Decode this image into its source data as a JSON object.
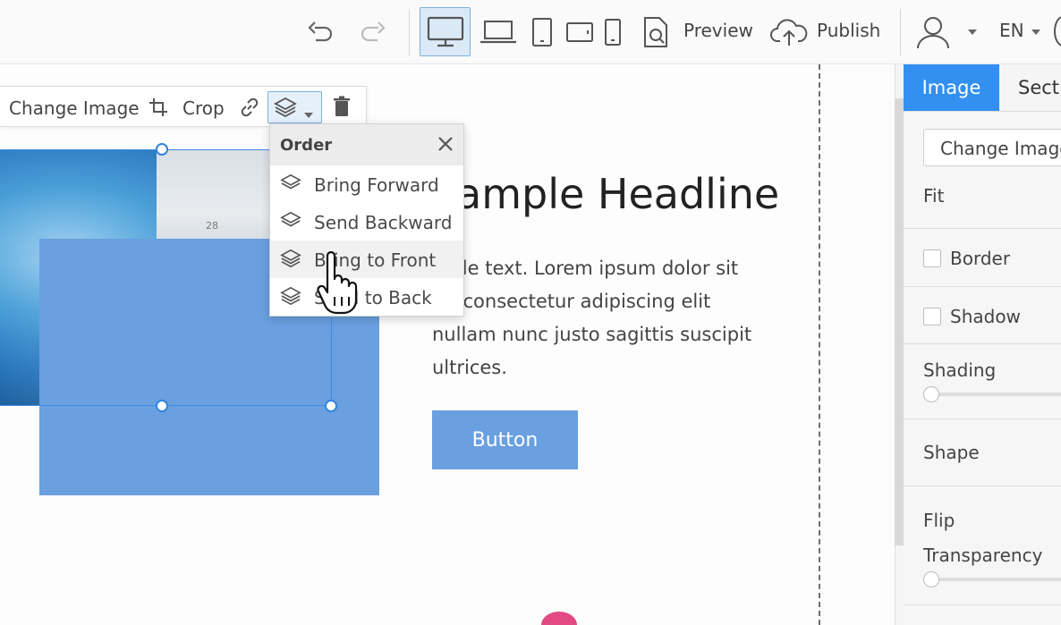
{
  "toolbar": {
    "undo_icon": "undo-icon",
    "redo_icon": "redo-icon",
    "devices": [
      "desktop-icon",
      "laptop-icon",
      "tablet-portrait-icon",
      "tablet-landscape-icon",
      "mobile-icon"
    ],
    "preview_label": "Preview",
    "publish_label": "Publish",
    "language": "EN",
    "colors": {
      "active_device_bg": "#dbe9f7",
      "active_device_border": "#7eb0de"
    }
  },
  "image_toolbar": {
    "change_image_label": "Change Image",
    "crop_label": "Crop"
  },
  "order_menu": {
    "title": "Order",
    "items": [
      {
        "label": "Bring Forward"
      },
      {
        "label": "Send Backward"
      },
      {
        "label": "Bring to Front"
      },
      {
        "label": "Send to Back"
      }
    ]
  },
  "content": {
    "headline": "ample Headline",
    "body_lines": [
      "mple text. Lorem ipsum dolor sit",
      "et, consectetur adipiscing elit",
      "nullam nunc justo sagittis suscipit",
      "ultrices."
    ],
    "button_label": "Button",
    "photo_date": "28",
    "colors": {
      "accent": "#6a9fe0",
      "selection": "#3b8fe6"
    }
  },
  "right_panel": {
    "tabs": [
      {
        "label": "Image",
        "active": true
      },
      {
        "label": "Sectio",
        "active": false
      }
    ],
    "change_image_label": "Change Image",
    "fit_label": "Fit",
    "border_label": "Border",
    "shadow_label": "Shadow",
    "shading_label": "Shading",
    "shape_label": "Shape",
    "flip_label": "Flip",
    "transparency_label": "Transparency",
    "accent_color": "#3390f0"
  }
}
